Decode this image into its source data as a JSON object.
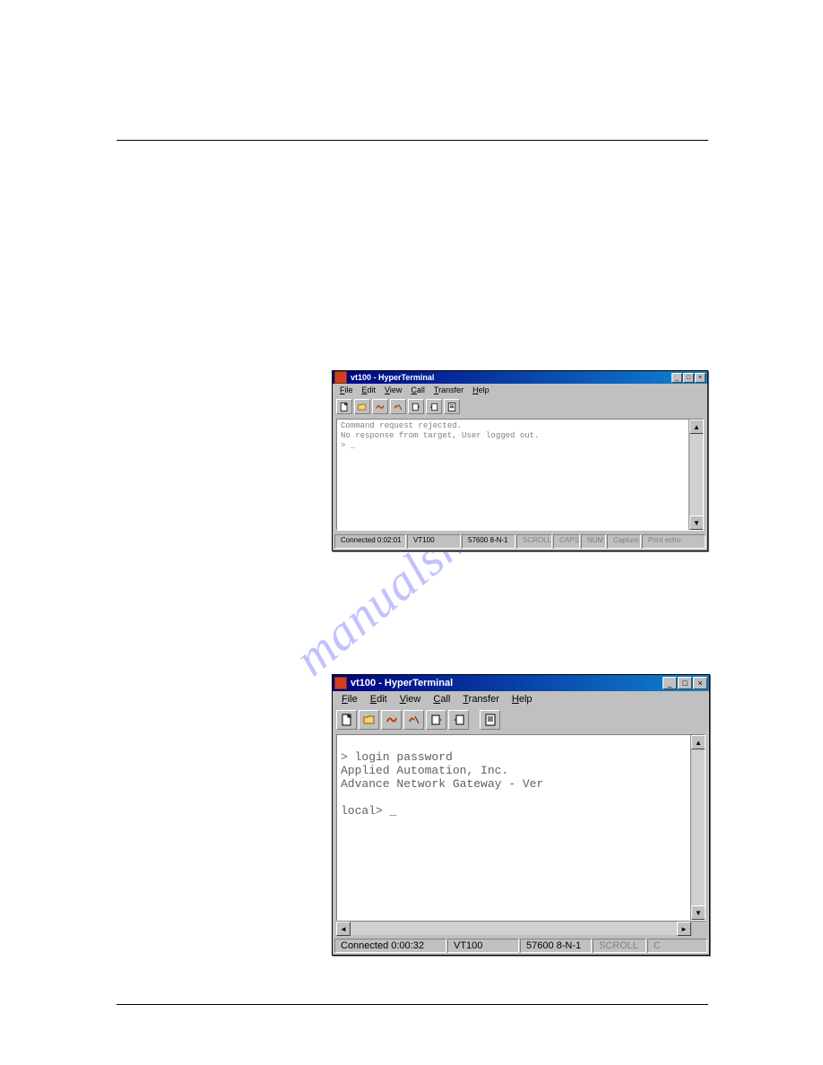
{
  "watermark": "manualshive.com",
  "small_window": {
    "title": "vt100 - HyperTerminal",
    "menus": [
      "File",
      "Edit",
      "View",
      "Call",
      "Transfer",
      "Help"
    ],
    "terminal_lines": "Command request rejected.\nNo response from target, User logged out.\n> _",
    "status": {
      "connected": "Connected 0:02:01",
      "emulation": "VT100",
      "settings": "57600 8-N-1",
      "scroll": "SCROLL",
      "caps": "CAPS",
      "num": "NUM",
      "capture": "Capture",
      "printecho": "Print echo"
    }
  },
  "large_window": {
    "title": "vt100 - HyperTerminal",
    "menus": [
      "File",
      "Edit",
      "View",
      "Call",
      "Transfer",
      "Help"
    ],
    "terminal_lines": "\n> login password\nApplied Automation, Inc.\nAdvance Network Gateway - Ver\n\nlocal> _",
    "status": {
      "connected": "Connected 0:00:32",
      "emulation": "VT100",
      "settings": "57600 8-N-1",
      "scroll": "SCROLL",
      "caps": "C"
    }
  }
}
